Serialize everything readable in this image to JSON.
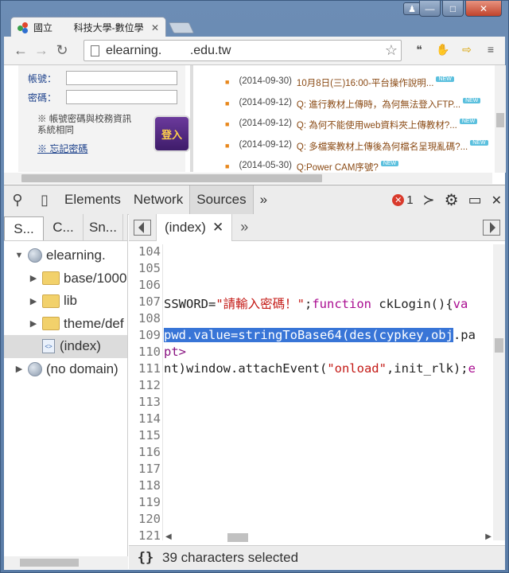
{
  "browser": {
    "tab_title": "國立        科技大學-數位學",
    "url": "elearning.        .edu.tw",
    "window_buttons": {
      "minimize": "—",
      "maximize": "□",
      "close": "✕"
    }
  },
  "page": {
    "account_label": "帳號：",
    "password_label": "密碼：",
    "note": "※ 帳號密碼與校務資訊系統相同",
    "forgot_link": "※ 忘記密碼",
    "login_button": "登入",
    "news": [
      {
        "date": "(2014-09-30)",
        "title": "10月8日(三)16:00-平台操作說明..."
      },
      {
        "date": "(2014-09-12)",
        "title": "Q: 進行教材上傳時，為何無法登入FTP..."
      },
      {
        "date": "(2014-09-12)",
        "title": "Q: 為何不能使用web資料夾上傳教材?..."
      },
      {
        "date": "(2014-09-12)",
        "title": "Q: 多檔案教材上傳後為何檔名呈現亂碼?..."
      },
      {
        "date": "(2014-05-30)",
        "title": "Q:Power CAM序號?"
      }
    ],
    "new_badge": "NEW"
  },
  "devtools": {
    "panels": [
      "Elements",
      "Network",
      "Sources"
    ],
    "more": "»",
    "error_count": "1",
    "navigator_tabs": [
      "S...",
      "C...",
      "Sn..."
    ],
    "tree": [
      {
        "label": "elearning.",
        "type": "domain",
        "expanded": true,
        "depth": 0
      },
      {
        "label": "base/1000",
        "type": "folder",
        "depth": 1
      },
      {
        "label": "lib",
        "type": "folder",
        "depth": 1
      },
      {
        "label": "theme/def",
        "type": "folder",
        "depth": 1
      },
      {
        "label": "(index)",
        "type": "file",
        "depth": 1,
        "selected": true
      },
      {
        "label": "(no domain)",
        "type": "domain",
        "expanded": false,
        "depth": 0
      }
    ],
    "editor_tab": "(index)",
    "line_numbers": [
      "104",
      "105",
      "106",
      "107",
      "108",
      "109",
      "110",
      "111",
      "112",
      "113",
      "114",
      "115",
      "116",
      "117",
      "118",
      "119",
      "120",
      "121"
    ],
    "code_107": "SSWORD=\"請輸入密碼！\";function ckLogin(){va",
    "code_109_selected": "pwd.value=stringToBase64(des(cypkey,obj",
    "code_109_rest": ".pa",
    "code_110": "pt>",
    "code_111": "nt)window.attachEvent(\"onload\",init_rlk);e",
    "status_text": "39 characters selected",
    "braces": "{}"
  }
}
